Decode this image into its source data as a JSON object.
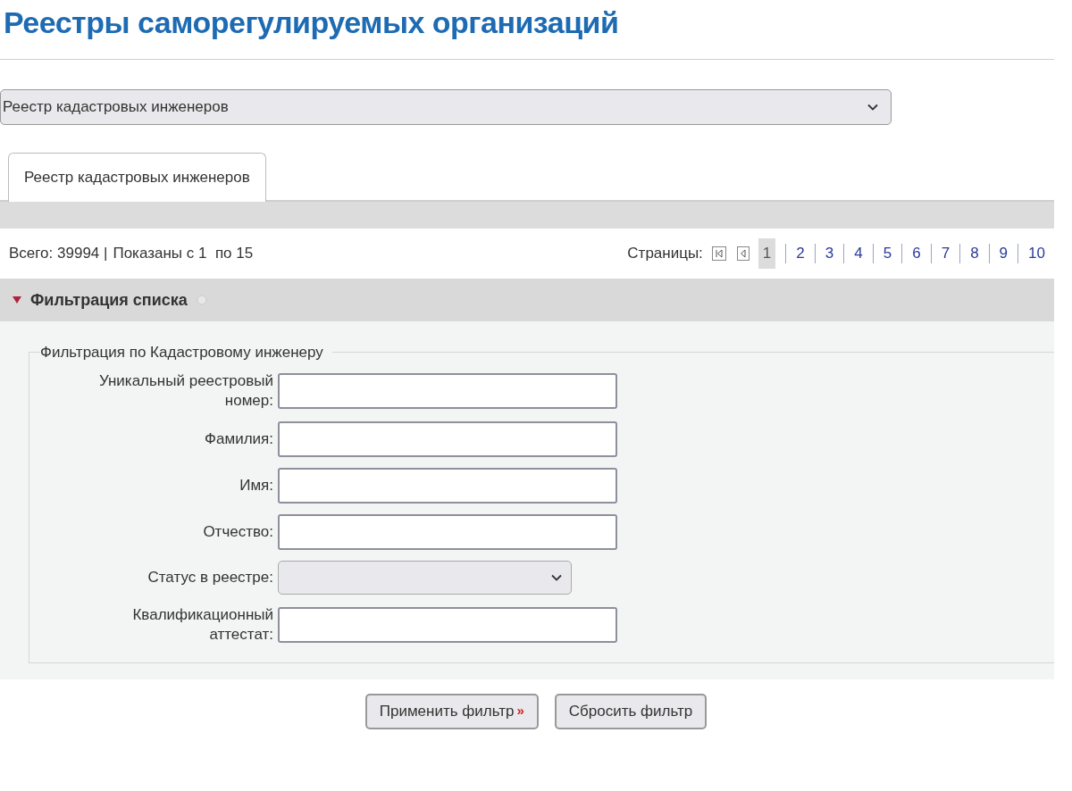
{
  "title": "Реестры саморегулируемых организаций",
  "registry_select": {
    "value": "Реестр кадастровых инженеров"
  },
  "tabs": [
    {
      "label": "Реестр кадастровых инженеров",
      "selected": true
    }
  ],
  "summary": {
    "total": "Всего: 39994 |",
    "shown": "Показаны с 1  по 15"
  },
  "pagination": {
    "label": "Страницы:",
    "pages": [
      {
        "label": "1",
        "selected": true
      },
      {
        "label": "2",
        "selected": false
      },
      {
        "label": "3",
        "selected": false
      },
      {
        "label": "4",
        "selected": false
      },
      {
        "label": "5",
        "selected": false
      },
      {
        "label": "6",
        "selected": false
      },
      {
        "label": "7",
        "selected": false
      },
      {
        "label": "8",
        "selected": false
      },
      {
        "label": "9",
        "selected": false
      },
      {
        "label": "10",
        "selected": false
      }
    ]
  },
  "filter": {
    "title": "Фильтрация списка",
    "expanded": true,
    "legend": "Фильтрация по Кадастровому инженеру",
    "fields": [
      {
        "kind": "text",
        "label": "Уникальный реестровый номер:"
      },
      {
        "kind": "text",
        "label": "Фамилия:"
      },
      {
        "kind": "text",
        "label": "Имя:"
      },
      {
        "kind": "text",
        "label": "Отчество:"
      },
      {
        "kind": "select",
        "label": "Статус в реестре:"
      },
      {
        "kind": "text",
        "label": "Квалификационный аттестат:"
      }
    ]
  },
  "buttons": [
    {
      "label": "Применить фильтр",
      "suffix": "»"
    },
    {
      "label": "Сбросить фильтр"
    }
  ]
}
